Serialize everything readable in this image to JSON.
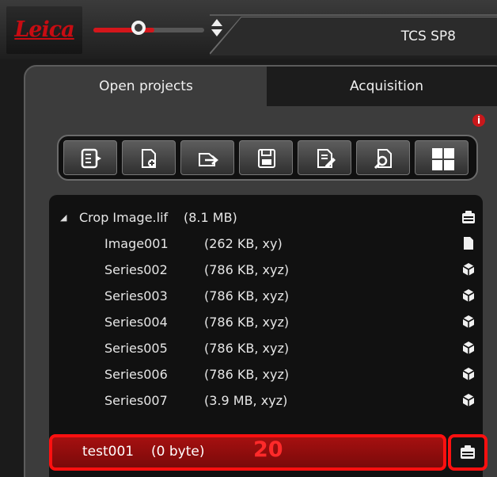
{
  "header": {
    "logo_text": "Leica",
    "instrument": "TCS SP8",
    "slider_level": 0.55
  },
  "tabs": [
    {
      "label": "Open projects",
      "active": true
    },
    {
      "label": "Acquisition",
      "active": false
    }
  ],
  "toolbar": {
    "icons": [
      "open-project-icon",
      "new-file-icon",
      "import-icon",
      "save-icon",
      "edit-icon",
      "find-icon",
      "grid-view-icon"
    ]
  },
  "tree": {
    "project": {
      "name": "Crop Image.lif",
      "meta": "(8.1 MB)",
      "icon": "project-icon"
    },
    "items": [
      {
        "name": "Image001",
        "meta": "(262 KB, xy)",
        "icon": "file-icon"
      },
      {
        "name": "Series002",
        "meta": "(786 KB, xyz)",
        "icon": "cube-icon"
      },
      {
        "name": "Series003",
        "meta": "(786 KB, xyz)",
        "icon": "cube-icon"
      },
      {
        "name": "Series004",
        "meta": "(786 KB, xyz)",
        "icon": "cube-icon"
      },
      {
        "name": "Series005",
        "meta": "(786 KB, xyz)",
        "icon": "cube-icon"
      },
      {
        "name": "Series006",
        "meta": "(786 KB, xyz)",
        "icon": "cube-icon"
      },
      {
        "name": "Series007",
        "meta": "(3.9 MB, xyz)",
        "icon": "cube-icon"
      }
    ],
    "highlight": {
      "name": "test001",
      "meta": "(0 byte)",
      "annotation": "20",
      "icon": "project-icon"
    }
  },
  "colors": {
    "accent": "#d4161b",
    "highlight_border": "#ff1010"
  }
}
